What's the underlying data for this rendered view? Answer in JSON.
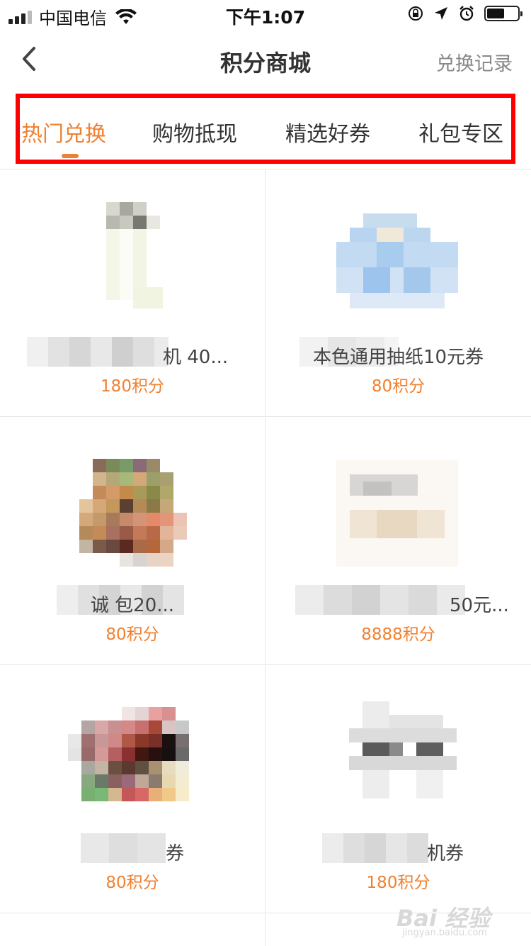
{
  "status_bar": {
    "carrier": "中国电信",
    "time": "下午1:07"
  },
  "nav": {
    "title": "积分商城",
    "right_label": "兑换记录"
  },
  "tabs": [
    {
      "label": "热门兑换",
      "active": true
    },
    {
      "label": "购物抵现",
      "active": false
    },
    {
      "label": "精选好券",
      "active": false
    },
    {
      "label": "礼包专区",
      "active": false
    }
  ],
  "products": [
    {
      "name": "机 40...",
      "points": "180积分"
    },
    {
      "name": "本色通用抽纸10元券",
      "points": "80积分"
    },
    {
      "name": "诚 包20...",
      "points": "80积分"
    },
    {
      "name": "50元...",
      "points": "8888积分"
    },
    {
      "name": "券",
      "points": "80积分"
    },
    {
      "name": "机券",
      "points": "180积分"
    }
  ],
  "watermark": {
    "logo": "Bai 经验",
    "url": "jingyan.baidu.com"
  },
  "colors": {
    "accent": "#f08030",
    "highlight_border": "#ff0000"
  }
}
